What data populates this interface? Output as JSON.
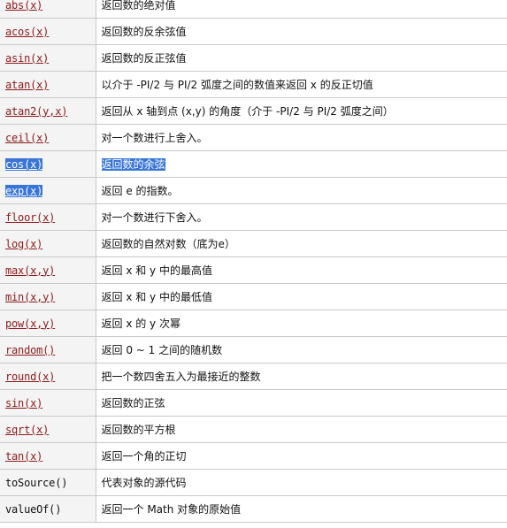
{
  "methods": [
    {
      "name": "abs(x)",
      "desc": "返回数的绝对值",
      "link": true
    },
    {
      "name": "acos(x)",
      "desc": "返回数的反余弦值",
      "link": true
    },
    {
      "name": "asin(x)",
      "desc": "返回数的反正弦值",
      "link": true
    },
    {
      "name": "atan(x)",
      "desc": "以介于 -PI/2 与 PI/2 弧度之间的数值来返回 x 的反正切值",
      "link": true
    },
    {
      "name": "atan2(y,x)",
      "desc": "返回从 x 轴到点 (x,y) 的角度（介于 -PI/2 与 PI/2 弧度之间）",
      "link": true
    },
    {
      "name": "ceil(x)",
      "desc": "对一个数进行上舍入。",
      "link": true
    },
    {
      "name": "cos(x)",
      "desc": "返回数的余弦",
      "link": true
    },
    {
      "name": "exp(x)",
      "desc": "返回 e 的指数。",
      "link": true
    },
    {
      "name": "floor(x)",
      "desc": "对一个数进行下舍入。",
      "link": true
    },
    {
      "name": "log(x)",
      "desc": "返回数的自然对数（底为e）",
      "link": true
    },
    {
      "name": "max(x,y)",
      "desc": "返回 x 和 y 中的最高值",
      "link": true
    },
    {
      "name": "min(x,y)",
      "desc": "返回 x 和 y 中的最低值",
      "link": true
    },
    {
      "name": "pow(x,y)",
      "desc": "返回 x 的 y 次幂",
      "link": true
    },
    {
      "name": "random()",
      "desc": "返回 0 ~ 1 之间的随机数",
      "link": true
    },
    {
      "name": "round(x)",
      "desc": "把一个数四舍五入为最接近的整数",
      "link": true
    },
    {
      "name": "sin(x)",
      "desc": "返回数的正弦",
      "link": true
    },
    {
      "name": "sqrt(x)",
      "desc": "返回数的平方根",
      "link": true
    },
    {
      "name": "tan(x)",
      "desc": "返回一个角的正切",
      "link": true
    },
    {
      "name": "toSource()",
      "desc": "代表对象的源代码",
      "link": false
    },
    {
      "name": "valueOf()",
      "desc": "返回一个 Math 对象的原始值",
      "link": false
    }
  ],
  "selection": {
    "highlighted": [
      "cos(x)",
      "返回数的余弦",
      "exp(x)"
    ]
  },
  "colors": {
    "link": "#8b1a1a",
    "selection": "#3875d7",
    "name_cell_bg": "#f4f4f4",
    "border": "#c9c9c9"
  }
}
